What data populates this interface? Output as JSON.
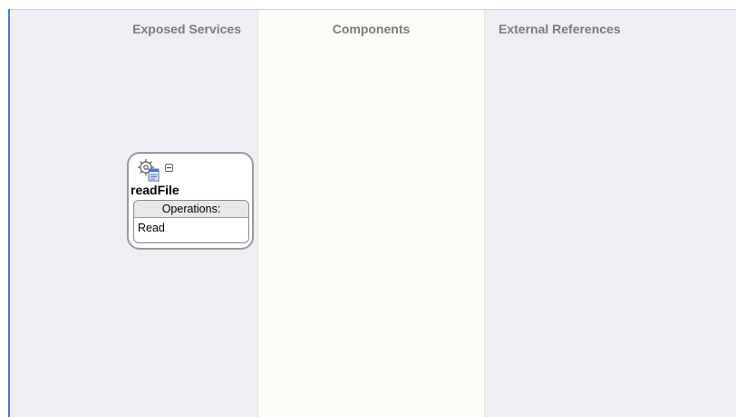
{
  "swimlanes": [
    {
      "title": "Exposed Services"
    },
    {
      "title": "Components"
    },
    {
      "title": "External References"
    }
  ],
  "service": {
    "name": "readFile",
    "icon": "gear-document-icon",
    "operations_header": "Operations:",
    "operations": [
      "Read"
    ]
  },
  "colors": {
    "lane_background": "#f0eef4",
    "components_background": "#fcfcf6",
    "left_rule": "#4a78c2",
    "title_text": "#7a7a7a"
  }
}
